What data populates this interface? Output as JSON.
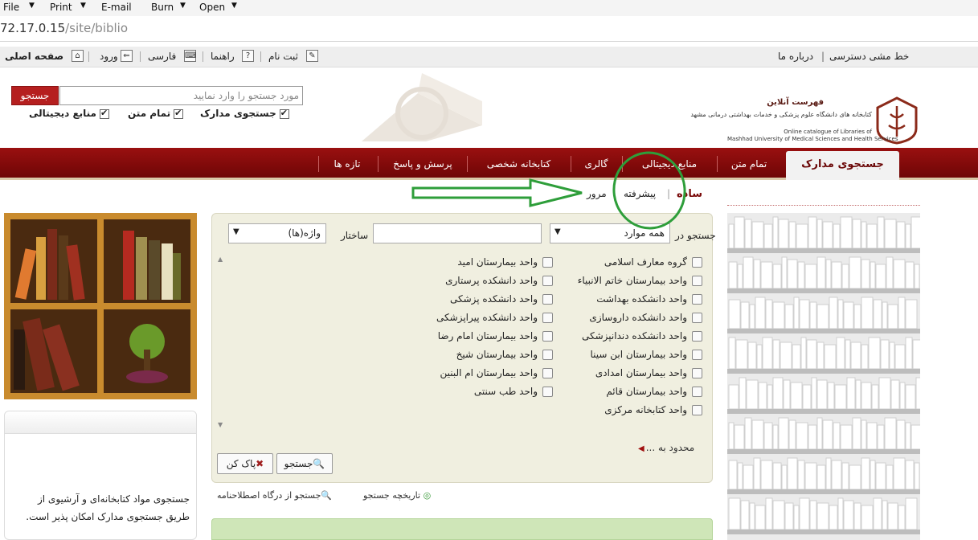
{
  "browser_menu": {
    "items": [
      "File",
      "Print",
      "E-mail",
      "Burn",
      "Open"
    ],
    "address": {
      "host": "72.17.0.15",
      "path": "/site/biblio"
    }
  },
  "site_toolbar": {
    "home": "صفحه اصلی",
    "login": "ورود",
    "language": "فارسی",
    "help": "راهنما",
    "register": "ثبت نام",
    "about": "درباره ما",
    "accessibility": "خط مشی دسترسی"
  },
  "header": {
    "search_placeholder": "مورد جستجو را وارد نمایید",
    "search_button": "جستجو",
    "scopes": [
      {
        "label": "جستجوی مدارک",
        "checked": true
      },
      {
        "label": "تمام متن",
        "checked": true
      },
      {
        "label": "منابع دیجیتالی",
        "checked": true
      }
    ],
    "logo": {
      "title": "فهرست آنلاین",
      "subtitle_fa": "کتابخانه های دانشگاه علوم پزشکی و خدمات بهداشتی درمانی مشهد",
      "subtitle_en_1": "Online catalogue of Libraries of",
      "subtitle_en_2": "Mashhad University of Medical Sciences and Health Services"
    }
  },
  "nav": {
    "tabs": [
      "جستجوی مدارک",
      "تمام متن",
      "منابع دیجیتالی",
      "گالری",
      "کتابخانه شخصی",
      "پرسش و پاسخ",
      "تازه ها"
    ]
  },
  "subtabs": {
    "simple": "ساده",
    "advanced": "پیشرفته",
    "browse": "مرور"
  },
  "search_form": {
    "search_in_label": "جستجو در",
    "all_items_value": "همه موارد",
    "structure_label": "ساختار",
    "structure_value": "",
    "words_value": "واژه(ها)",
    "units_right": [
      "گروه معارف اسلامی",
      "واحد بیمارستان خاتم الانبیاء",
      "واحد دانشکده بهداشت",
      "واحد دانشکده داروسازی",
      "واحد دانشکده دندانپزشکی",
      "واحد بیمارستان ابن سینا",
      "واحد بیمارستان امدادی",
      "واحد بیمارستان قائم",
      "واحد کتابخانه مرکزی"
    ],
    "units_left": [
      "واحد بیمارستان امید",
      "واحد دانشکده پرستاری",
      "واحد دانشکده پزشکی",
      "واحد دانشکده پیراپزشکی",
      "واحد بیمارستان امام رضا",
      "واحد بیمارستان شیخ",
      "واحد بیمارستان ام البنین",
      "واحد طب سنتی"
    ],
    "limit_label": "محدود به ...",
    "search_button": "جستجو",
    "clear_button": "پاک کن"
  },
  "bottom_links": {
    "history": "تاریخچه جستجو",
    "portal": "جستجو از درگاه اصطلاحنامه"
  },
  "left_panel": {
    "description": "جستجوی مواد کتابخانه‌ای و آرشیوی از طریق جستجوی مدارک امکان پذیر است."
  },
  "colors": {
    "nav_red": "#8b0b0b",
    "search_red": "#b51f1f",
    "annotation_green": "#2e9e3a",
    "panel_bg": "#f0efe0"
  }
}
